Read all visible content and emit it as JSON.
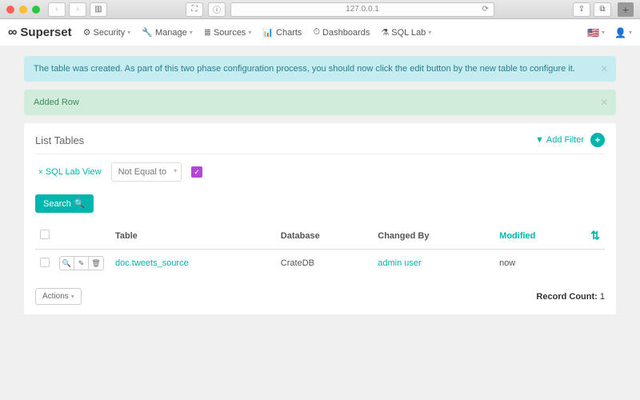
{
  "browser": {
    "url": "127.0.0.1"
  },
  "navbar": {
    "brand": "Superset",
    "items": [
      {
        "label": "Security",
        "icon": "⚙"
      },
      {
        "label": "Manage",
        "icon": "✎"
      },
      {
        "label": "Sources",
        "icon": "☰"
      },
      {
        "label": "Charts",
        "icon": "⫾"
      },
      {
        "label": "Dashboards",
        "icon": "⊞"
      },
      {
        "label": "SQL Lab",
        "icon": "⚗"
      }
    ]
  },
  "alerts": {
    "info": "The table was created. As part of this two phase configuration process, you should now click the edit button by the new table to configure it.",
    "success": "Added Row"
  },
  "panel": {
    "title": "List Tables",
    "add_filter_label": "Add Filter",
    "filter": {
      "field": "SQL Lab View",
      "operator": "Not Equal to"
    },
    "search_label": "Search",
    "columns": {
      "table": "Table",
      "database": "Database",
      "changed_by": "Changed By",
      "modified": "Modified"
    },
    "rows": [
      {
        "table": "doc.tweets_source",
        "database": "CrateDB",
        "changed_by": "admin user",
        "modified": "now"
      }
    ],
    "actions_label": "Actions",
    "record_count_label": "Record Count:",
    "record_count": "1"
  }
}
